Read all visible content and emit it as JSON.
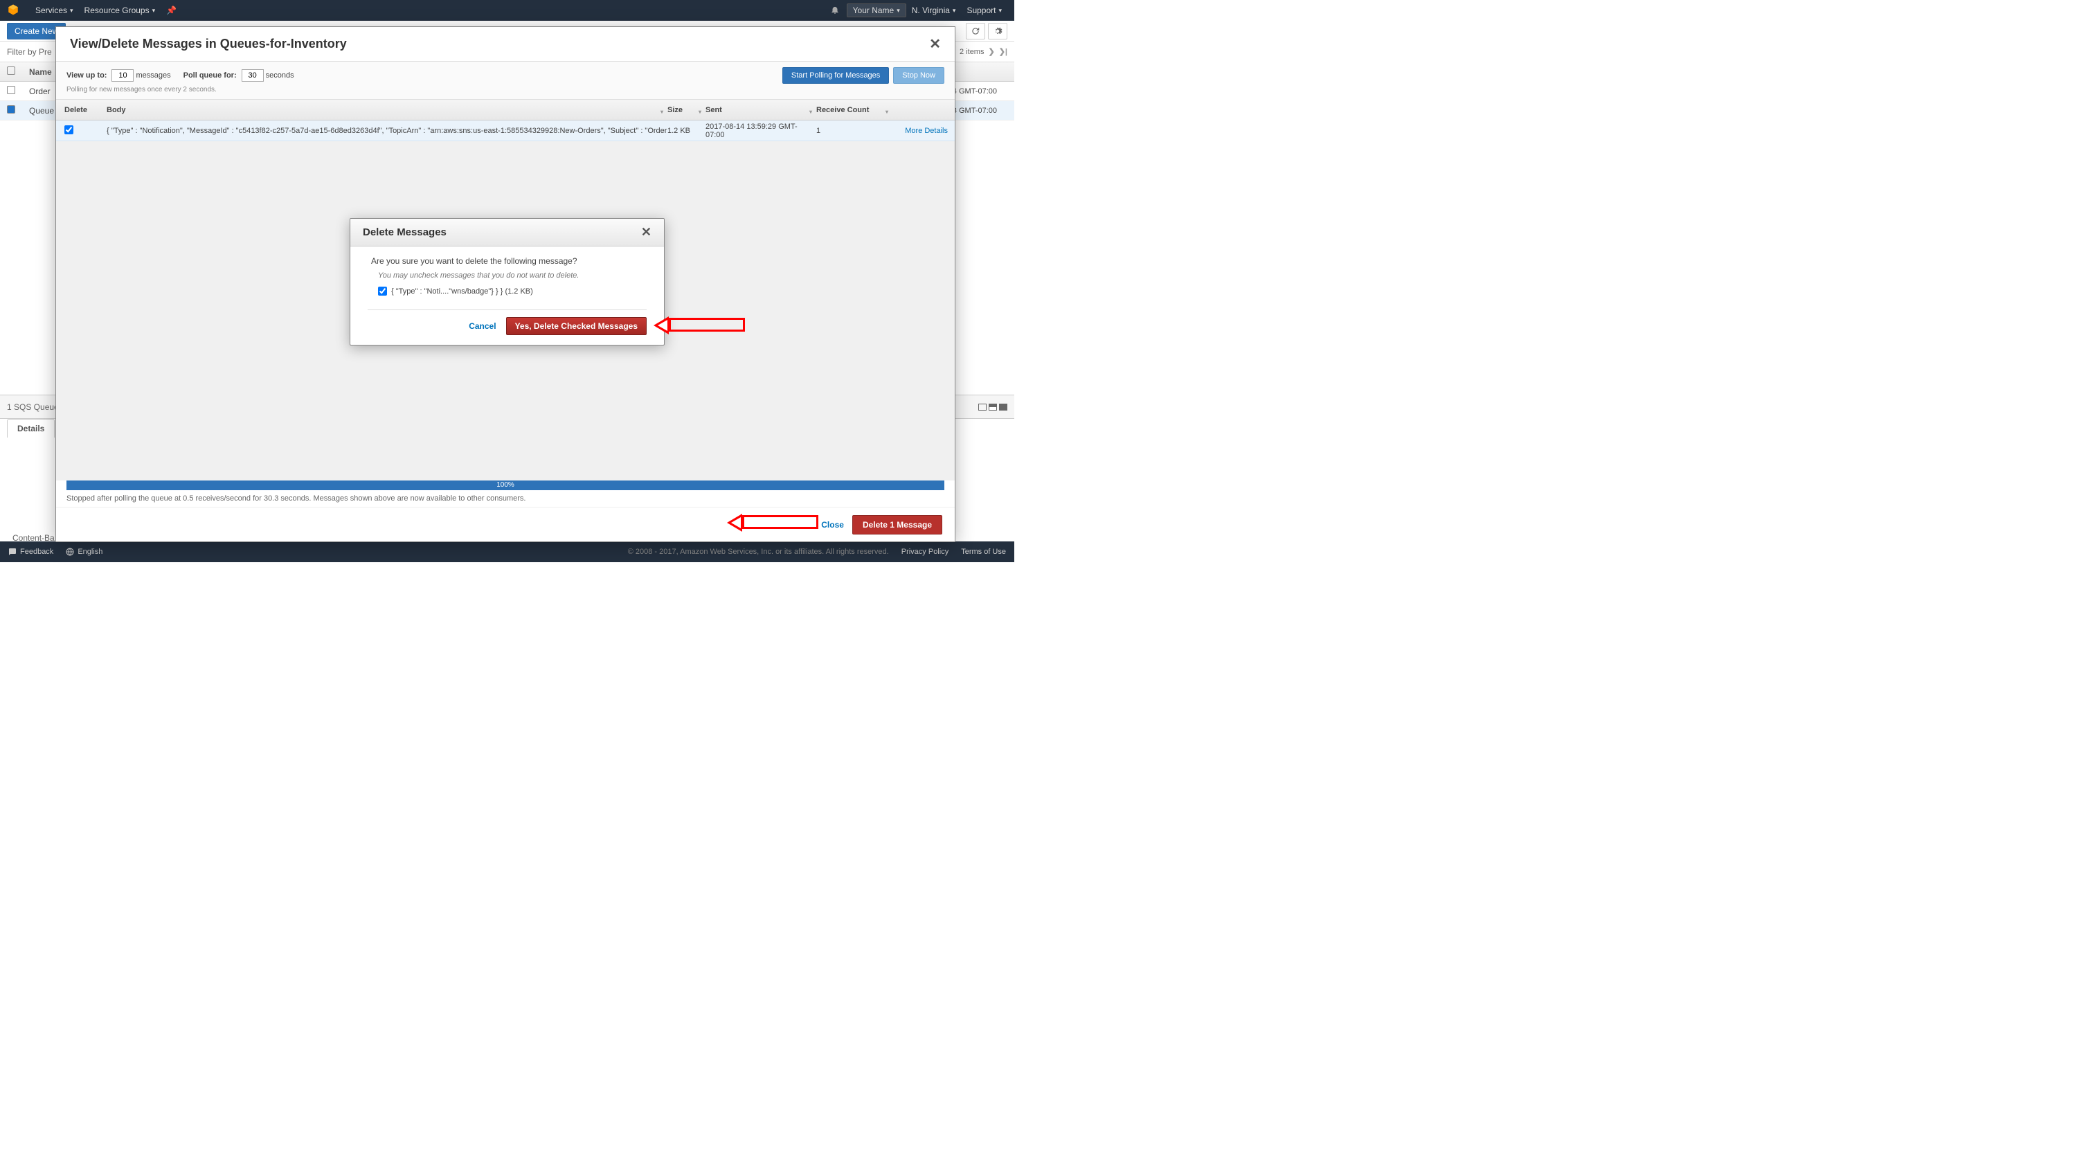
{
  "topnav": {
    "services": "Services",
    "resource_groups": "Resource Groups",
    "your_name": "Your Name",
    "region": "N. Virginia",
    "support": "Support"
  },
  "toolbar": {
    "create_new": "Create New"
  },
  "filter": {
    "label": "Filter by Pre",
    "items_suffix": "2 items"
  },
  "queue_table": {
    "header_name": "Name",
    "rows": [
      {
        "name": "Order",
        "created": "4 GMT-07:00",
        "selected": false
      },
      {
        "name": "Queue",
        "created": "3 GMT-07:00",
        "selected": true
      }
    ]
  },
  "details": {
    "strip_label": "1 SQS Queue",
    "tab": "Details",
    "content_label": "Content-Ba"
  },
  "modal1": {
    "title": "View/Delete Messages in Queues-for-Inventory",
    "view_up_to_label": "View up to:",
    "view_up_to_value": "10",
    "messages_unit": "messages",
    "poll_for_label": "Poll queue for:",
    "poll_for_value": "30",
    "seconds_unit": "seconds",
    "subtext": "Polling for new messages once every 2 seconds.",
    "btn_start": "Start Polling for Messages",
    "btn_stop": "Stop Now",
    "headers": {
      "delete": "Delete",
      "body": "Body",
      "size": "Size",
      "sent": "Sent",
      "receive_count": "Receive Count"
    },
    "row": {
      "body": "{ \"Type\" : \"Notification\", \"MessageId\" : \"c5413f82-c257-5a7d-ae15-6d8ed3263d4f\", \"TopicArn\" : \"arn:aws:sns:us-east-1:585534329928:New-Orders\", \"Subject\" : \"Order",
      "size": "1.2 KB",
      "sent": "2017-08-14 13:59:29 GMT-07:00",
      "rcv": "1",
      "more": "More Details"
    },
    "progress_text": "100%",
    "status": "Stopped after polling the queue at 0.5 receives/second for 30.3 seconds. Messages shown above are now available to other consumers.",
    "close": "Close",
    "delete_btn": "Delete 1 Message"
  },
  "modal2": {
    "title": "Delete Messages",
    "question": "Are you sure you want to delete the following message?",
    "hint": "You may uncheck messages that you do not want to delete.",
    "item": "{ \"Type\" : \"Noti....\"wns/badge\"} } } (1.2 KB)",
    "cancel": "Cancel",
    "confirm": "Yes, Delete Checked Messages"
  },
  "footer": {
    "feedback": "Feedback",
    "language": "English",
    "copyright": "© 2008 - 2017, Amazon Web Services, Inc. or its affiliates. All rights reserved.",
    "privacy": "Privacy Policy",
    "terms": "Terms of Use"
  }
}
